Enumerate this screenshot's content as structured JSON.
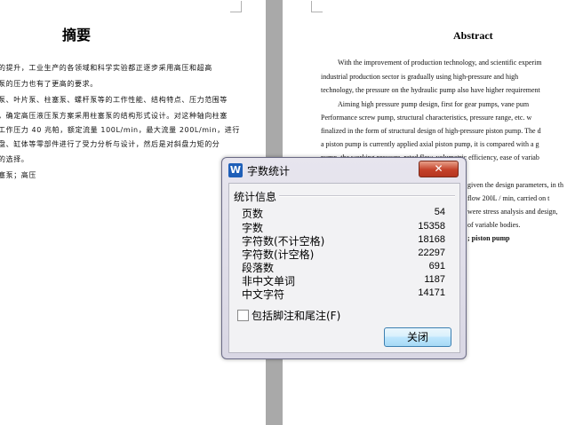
{
  "left_page": {
    "title": "摘要",
    "lines": [
      "的提升，工业生产的各领域和科学实验都正逐步采用高压和超高",
      "泵的压力也有了更高的要求。",
      "泵、叶片泵、柱塞泵、螺杆泵等的工作性能、结构特点、压力范围等",
      "，确定高压液压泵方案采用柱塞泵的结构形式设计。对这种轴向柱塞",
      "工作压力 40 兆帕，额定流量 100L/min，最大流量 200L/min，进行",
      "盘、缸体等零部件进行了受力分析与设计，然后是对斜盘力矩的分",
      "的选择。",
      "塞泵；高压"
    ]
  },
  "right_page": {
    "title": "Abstract",
    "lines": [
      "With the improvement of production technology, and scientific experim",
      "industrial production sector is gradually using high-pressure and high",
      "technology, the pressure on the hydraulic pump also have higher requirement",
      "Aiming high pressure pump design, first for gear pumps, vane pum",
      "Performance screw pump, structural characteristics, pressure range, etc. w",
      "finalized in the form of structural design of high-pressure piston pump. The d",
      "a piston pump is currently applied axial piston pump, it is compared with a g",
      "pump, the working pressure, rated flow, volumetric efficiency, ease of variab",
      "given the design parameters, in th",
      "flow 200L / min, carried on t",
      "were stress analysis and design,",
      "of variable bodies.",
      "; piston pump"
    ]
  },
  "dialog": {
    "title": "字数统计",
    "close_x": "✕",
    "group_label": "统计信息",
    "stats": [
      {
        "label": "页数",
        "value": "54"
      },
      {
        "label": "字数",
        "value": "15358"
      },
      {
        "label": "字符数(不计空格)",
        "value": "18168"
      },
      {
        "label": "字符数(计空格)",
        "value": "22297"
      },
      {
        "label": "段落数",
        "value": "691"
      },
      {
        "label": "非中文单词",
        "value": "1187"
      },
      {
        "label": "中文字符",
        "value": "14171"
      }
    ],
    "checkbox_label": "包括脚注和尾注(F)",
    "close_button": "关闭",
    "app_icon_glyph": "W"
  }
}
